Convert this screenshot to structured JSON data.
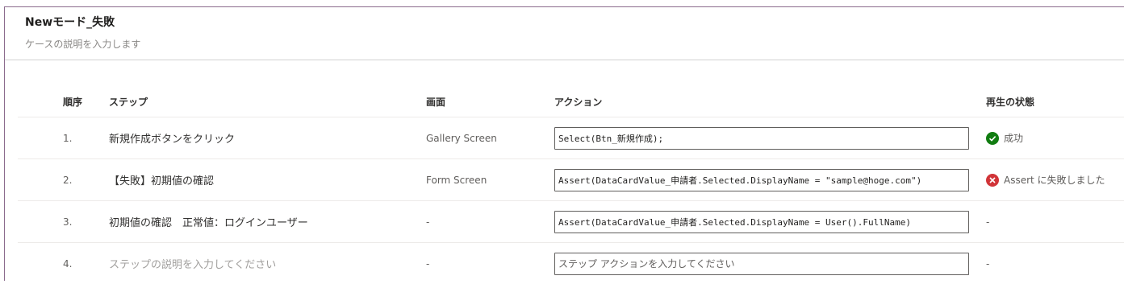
{
  "header": {
    "title": "Newモード_失敗",
    "description_placeholder": "ケースの説明を入力します"
  },
  "columns": {
    "order": "順序",
    "step": "ステップ",
    "screen": "画面",
    "action": "アクション",
    "status": "再生の状態"
  },
  "rows": [
    {
      "order": "1.",
      "step": "新規作成ボタンをクリック",
      "screen": "Gallery Screen",
      "action": "Select(Btn_新規作成);",
      "status": "成功",
      "status_icon": "check-circle-icon"
    },
    {
      "order": "2.",
      "step": "【失敗】初期値の確認",
      "screen": "Form Screen",
      "action": "Assert(DataCardValue_申請者.Selected.DisplayName = \"sample@hoge.com\")",
      "status": "Assert に失敗しました",
      "status_icon": "error-circle-icon"
    },
    {
      "order": "3.",
      "step": "初期値の確認　正常値：ログインユーザー",
      "screen": "-",
      "action": "Assert(DataCardValue_申請者.Selected.DisplayName = User().FullName)",
      "status": "-"
    },
    {
      "order": "4.",
      "step_placeholder": "ステップの説明を入力してください",
      "screen": "-",
      "action_placeholder": "ステップ アクションを入力してください",
      "status": "-"
    }
  ],
  "colors": {
    "success": "#107c10",
    "failure": "#d13438",
    "frame_border": "#8a6a8c"
  }
}
